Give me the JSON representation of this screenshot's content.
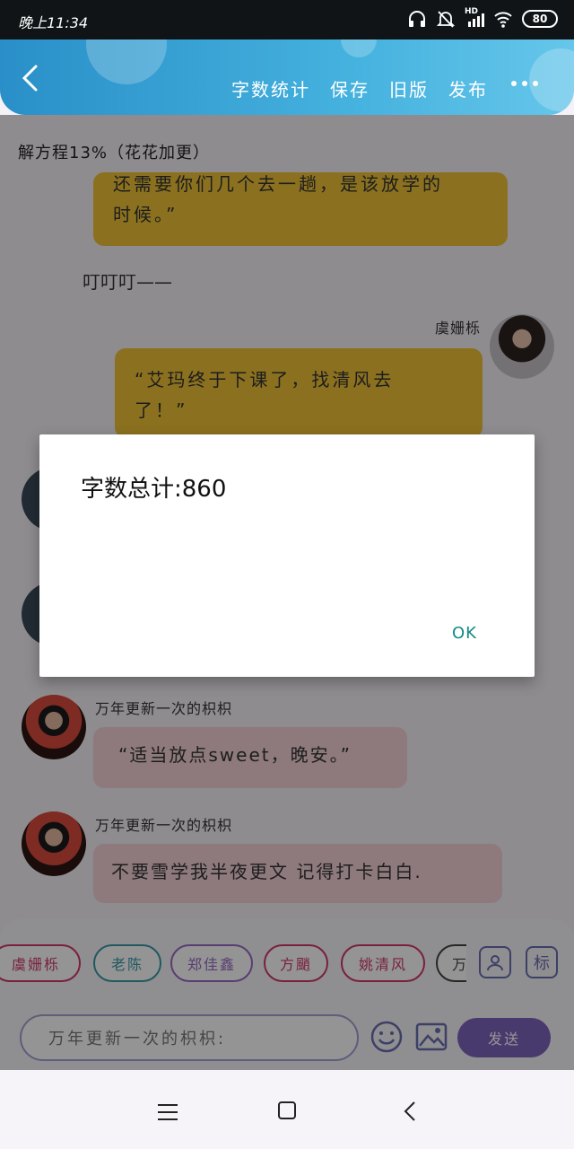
{
  "status_bar": {
    "time": "晚上11:34",
    "network": "HD",
    "battery": "80"
  },
  "header": {
    "links": [
      "字数统计",
      "保存",
      "旧版",
      "发布"
    ]
  },
  "chat": {
    "progress_title": "解方程13%（花花加更）",
    "msg1_line1": "还需要你们几个去一趟，是该放学的",
    "msg1_line2": "时候。”",
    "plain_text": "叮叮叮——",
    "msg2_name": "虞姗栎",
    "msg2_line1": "“艾玛终于下课了，找清风去",
    "msg2_line2": "了！”",
    "msg3_name": "万年更新一次的枳枳",
    "msg3_text": "“适当放点sweet，晚安。”",
    "msg4_name": "万年更新一次的枳枳",
    "msg4_text": "不要雪学我半夜更文 记得打卡白白."
  },
  "dialog": {
    "text": "字数总计:860",
    "ok_label": "OK"
  },
  "composer": {
    "chips": [
      "虞姗栎",
      "老陈",
      "郑佳鑫",
      "方颵",
      "姚清风",
      "万"
    ],
    "chip_colors": [
      "#d0386a",
      "#3a9aa8",
      "#9a6ac4",
      "#d0386a",
      "#d0386a",
      "#444444"
    ],
    "placeholder": "万年更新一次的枳枳:",
    "send_label": "发送",
    "tag_label": "标"
  }
}
